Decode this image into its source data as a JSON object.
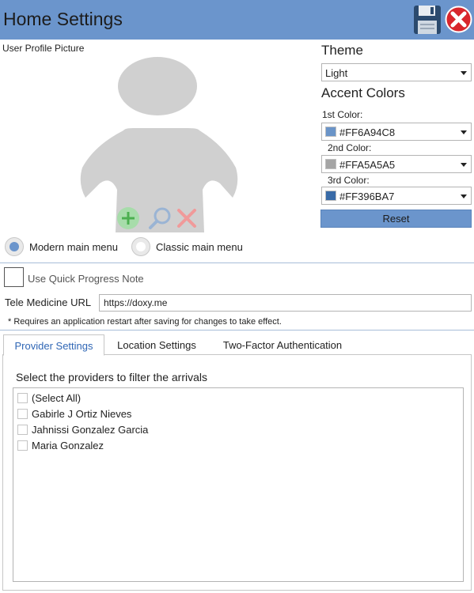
{
  "header": {
    "title": "Home Settings",
    "save_icon": "floppy-disk-icon",
    "close_icon": "close-icon",
    "bar_color": "#6B95CC"
  },
  "profile": {
    "label": "User Profile Picture",
    "avatar_icon": "user-silhouette-icon",
    "actions": [
      "add-icon",
      "zoom-icon",
      "delete-icon"
    ]
  },
  "menu_style": {
    "options": [
      {
        "label": "Modern main menu",
        "selected": true
      },
      {
        "label": "Classic main menu",
        "selected": false
      }
    ]
  },
  "theme": {
    "heading": "Theme",
    "value": "Light"
  },
  "accent": {
    "heading": "Accent Colors",
    "colors": [
      {
        "label": "1st Color:",
        "value": "#FF6A94C8",
        "swatch": "#6A94C8"
      },
      {
        "label": "2nd Color:",
        "value": "#FFA5A5A5",
        "swatch": "#A5A5A5"
      },
      {
        "label": "3rd Color:",
        "value": "#FF396BA7",
        "swatch": "#396BA7"
      }
    ],
    "reset_label": "Reset"
  },
  "options": {
    "quick_progress_label": "Use Quick Progress Note",
    "quick_progress_checked": false,
    "tele_label": "Tele Medicine URL",
    "tele_value": "https://doxy.me",
    "restart_note": "* Requires an application restart after saving for changes to take effect."
  },
  "tabs": [
    {
      "label": "Provider Settings",
      "active": true
    },
    {
      "label": "Location Settings",
      "active": false
    },
    {
      "label": "Two-Factor Authentication",
      "active": false
    }
  ],
  "provider_settings": {
    "filter_label": "Select the providers to filter the arrivals",
    "items": [
      {
        "label": "(Select All)",
        "checked": false
      },
      {
        "label": "Gabirle J Ortiz Nieves",
        "checked": false
      },
      {
        "label": "Jahnissi Gonzalez Garcia",
        "checked": false
      },
      {
        "label": "Maria Gonzalez",
        "checked": false
      }
    ]
  }
}
